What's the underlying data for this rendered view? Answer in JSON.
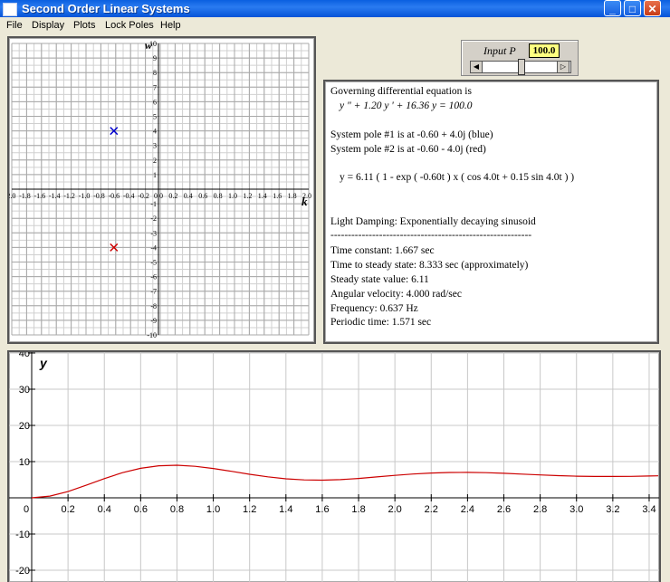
{
  "window": {
    "title": "Second Order Linear Systems"
  },
  "menu": [
    "File",
    "Display",
    "Plots",
    "Lock Poles",
    "Help"
  ],
  "pole_plot": {
    "y_axis_label": "w",
    "x_axis_label": "k",
    "x_ticks": [
      "-2.0",
      "-1.8",
      "-1.6",
      "-1.4",
      "-1.2",
      "-1.0",
      "-0.8",
      "-0.6",
      "-0.4",
      "-0.2",
      "0.0",
      "0.2",
      "0.4",
      "0.6",
      "0.8",
      "1.0",
      "1.2",
      "1.4",
      "1.6",
      "1.8",
      "2.0"
    ],
    "y_ticks": [
      "10",
      "9",
      "8",
      "7",
      "6",
      "5",
      "4",
      "3",
      "2",
      "1",
      "-1",
      "-2",
      "-3",
      "-4",
      "-5",
      "-6",
      "-7",
      "-8",
      "-9",
      "-10"
    ],
    "poles": [
      {
        "re": -0.6,
        "im": 4.0,
        "color": "#0000cc"
      },
      {
        "re": -0.6,
        "im": -4.0,
        "color": "#cc0000"
      }
    ]
  },
  "input": {
    "label": "Input P",
    "value": "100.0"
  },
  "info": {
    "line1": "Governing differential equation is",
    "equation": "y \" + 1.20 y ' + 16.36 y  =  100.0",
    "pole1": "System pole #1 is at -0.60 + 4.0j        (blue)",
    "pole2": "System pole #2 is at -0.60 - 4.0j        (red)",
    "solution": "y  = 6.11 ( 1 - exp ( -0.60t  ) x ( cos 4.0t   + 0.15 sin 4.0t  ) )",
    "damping": "Light Damping: Exponentially decaying sinusoid",
    "divider": "----------------------------------------------------------",
    "time_constant": "Time constant: 1.667 sec",
    "steady_time": "Time to steady state: 8.333 sec (approximately)",
    "steady_value": "Steady state value: 6.11",
    "angular_velocity": "Angular velocity: 4.000 rad/sec",
    "frequency": "Frequency: 0.637 Hz",
    "period": "Periodic time: 1.571 sec"
  },
  "chart_data": {
    "type": "line",
    "ylabel": "y",
    "xlim": [
      0,
      3.45
    ],
    "ylim": [
      -22,
      40
    ],
    "x_ticks": [
      "0",
      "0.2",
      "0.4",
      "0.6",
      "0.8",
      "1.0",
      "1.2",
      "1.4",
      "1.6",
      "1.8",
      "2.0",
      "2.2",
      "2.4",
      "2.6",
      "2.8",
      "3.0",
      "3.2",
      "3.4"
    ],
    "y_ticks": [
      "40",
      "30",
      "20",
      "10",
      "-10",
      "-20"
    ],
    "series": [
      {
        "color": "#cc0000",
        "x": [
          0,
          0.1,
          0.2,
          0.3,
          0.4,
          0.5,
          0.6,
          0.7,
          0.8,
          0.9,
          1.0,
          1.1,
          1.2,
          1.3,
          1.4,
          1.5,
          1.6,
          1.7,
          1.8,
          1.9,
          2.0,
          2.1,
          2.2,
          2.3,
          2.4,
          2.5,
          2.6,
          2.7,
          2.8,
          2.9,
          3.0,
          3.1,
          3.2,
          3.3,
          3.4,
          3.45
        ],
        "y": [
          0,
          0.47,
          1.73,
          3.47,
          5.31,
          6.95,
          8.16,
          8.85,
          9.0,
          8.7,
          8.09,
          7.32,
          6.51,
          5.79,
          5.25,
          4.94,
          4.87,
          5.03,
          5.36,
          5.77,
          6.2,
          6.57,
          6.85,
          7.0,
          7.03,
          6.94,
          6.77,
          6.55,
          6.32,
          6.12,
          5.98,
          5.9,
          5.89,
          5.93,
          6.02,
          6.07
        ]
      }
    ]
  }
}
